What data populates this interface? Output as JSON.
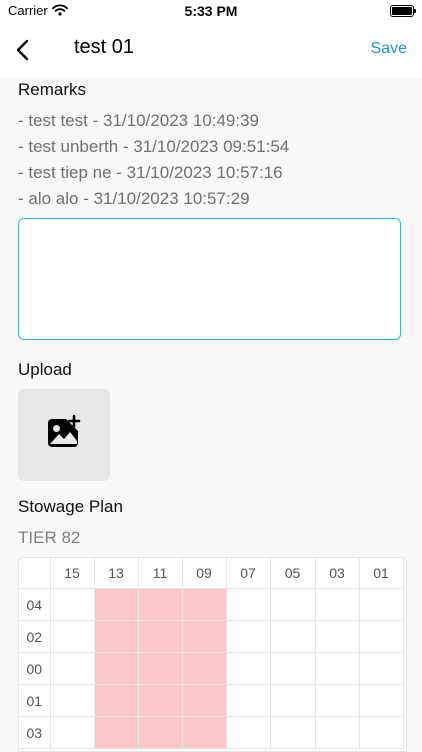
{
  "status_bar": {
    "carrier": "Carrier",
    "time": "5:33 PM"
  },
  "nav": {
    "title": "test 01",
    "save_label": "Save"
  },
  "remarks": {
    "title": "Remarks",
    "items": [
      "- test test - 31/10/2023 10:49:39",
      "- test unberth - 31/10/2023 09:51:54",
      "- test tiep ne - 31/10/2023 10:57:16",
      "- alo alo - 31/10/2023 10:57:29"
    ],
    "input_value": ""
  },
  "upload": {
    "title": "Upload",
    "icon": "add-image-icon"
  },
  "stowage": {
    "title": "Stowage Plan",
    "tier": "TIER 82",
    "columns": [
      "15",
      "13",
      "11",
      "09",
      "07",
      "05",
      "03",
      "01"
    ],
    "rows": [
      "04",
      "02",
      "00",
      "01",
      "03"
    ],
    "occupied_columns": [
      "13",
      "11",
      "09"
    ],
    "occupied_color": "#fbc7c9"
  },
  "colors": {
    "accent": "#1e8ee0",
    "input_border": "#3fb6c8"
  }
}
